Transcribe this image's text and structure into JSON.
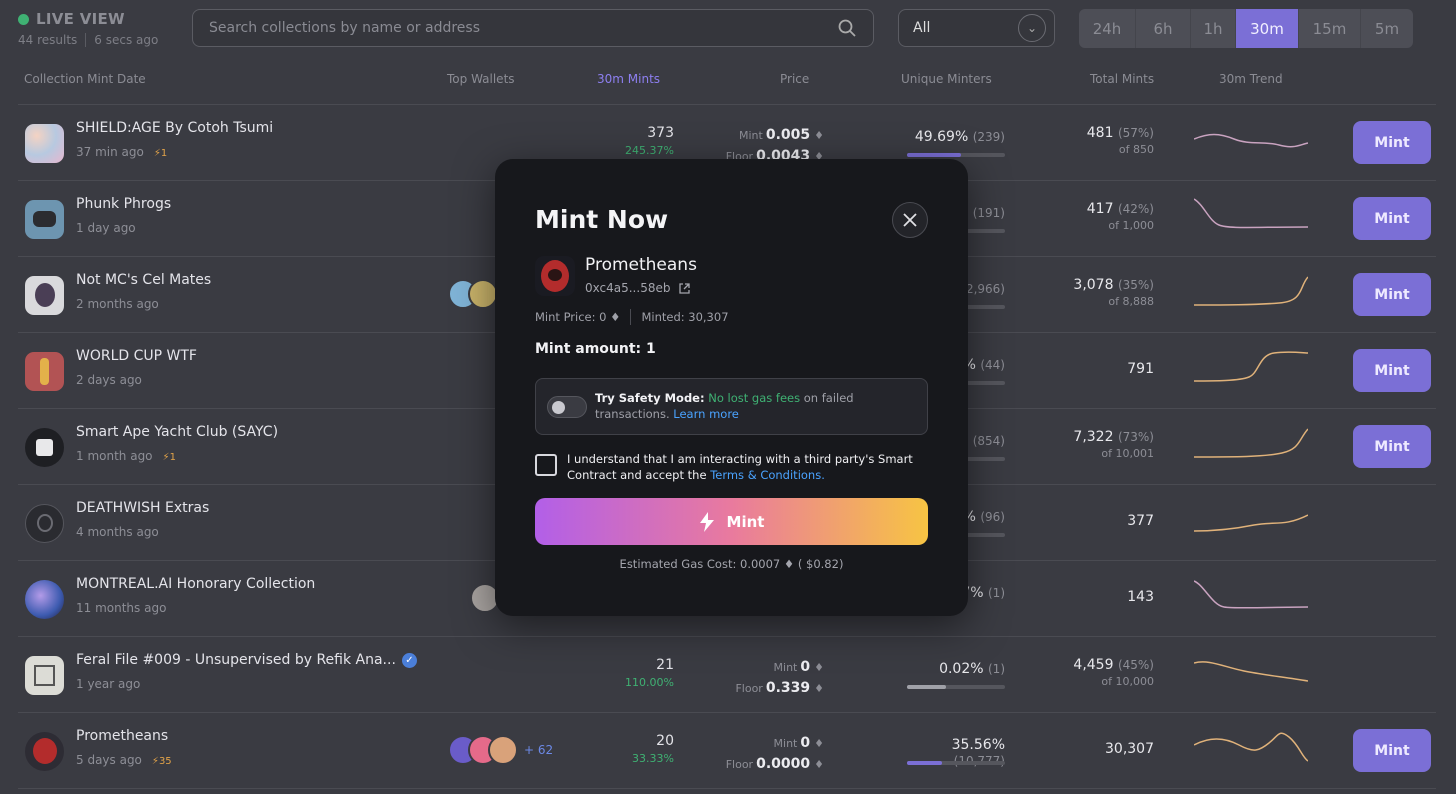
{
  "header": {
    "live_label": "LIVE VIEW",
    "results": "44 results",
    "updated": "6 secs ago",
    "search_placeholder": "Search collections by name or address",
    "filter_value": "All",
    "time_options": [
      "24h",
      "6h",
      "1h",
      "30m",
      "15m",
      "5m"
    ],
    "time_active": "30m"
  },
  "columns": {
    "collection": "Collection Mint Date",
    "top_wallets": "Top Wallets",
    "mints": "30m Mints",
    "price": "Price",
    "unique": "Unique Minters",
    "total": "Total Mints",
    "trend": "30m Trend"
  },
  "rows": [
    {
      "name": "SHIELD:AGE By Cotoh Tsumi",
      "age": "37 min ago",
      "tag": "1",
      "mints": "373",
      "mints_pct": "245.37%",
      "mint_label": "Mint",
      "mint_price": "0.005",
      "floor_label": "Floor",
      "floor_price": "0.0043",
      "unique_pct": "49.69%",
      "unique_cnt": "(239)",
      "unique_fill": 0.5,
      "total": "481",
      "total_pct": "(57%)",
      "total_of": "of 850",
      "has_button": true,
      "button": "Mint"
    },
    {
      "name": "Phunk Phrogs",
      "age": "1 day ago",
      "tag": "",
      "mints": "",
      "mints_pct": "",
      "unique_pct": "%",
      "unique_cnt": "(191)",
      "unique_fill": 0.4,
      "total": "417",
      "total_pct": "(42%)",
      "total_of": "of 1,000",
      "has_button": true,
      "button": "Mint"
    },
    {
      "name": "Not MC's Cel Mates",
      "age": "2 months ago",
      "tag": "",
      "unique_pct": "",
      "unique_cnt": "2,966)",
      "unique_fill": 0.35,
      "total": "3,078",
      "total_pct": "(35%)",
      "total_of": "of 8,888",
      "has_button": true,
      "button": "Mint"
    },
    {
      "name": "WORLD CUP WTF",
      "age": "2 days ago",
      "tag": "",
      "unique_pct": "%",
      "unique_cnt": "(44)",
      "unique_fill": 0.3,
      "total": "791",
      "total_pct": "",
      "total_of": "",
      "has_button": true,
      "button": "Mint"
    },
    {
      "name": "Smart Ape Yacht Club (SAYC)",
      "age": "1 month ago",
      "tag": "1",
      "unique_pct": "",
      "unique_cnt": "(854)",
      "unique_fill": 0.3,
      "total": "7,322",
      "total_pct": "(73%)",
      "total_of": "of 10,001",
      "has_button": true,
      "button": "Mint"
    },
    {
      "name": "DEATHWISH Extras",
      "age": "4 months ago",
      "tag": "",
      "unique_pct": "%",
      "unique_cnt": "(96)",
      "unique_fill": 0.3,
      "total": "377",
      "total_pct": "",
      "total_of": "",
      "has_button": false
    },
    {
      "name": "MONTREAL.AI Honorary Collection",
      "age": "11 months ago",
      "tag": "",
      "unique_pct": "7%",
      "unique_cnt": "(1)",
      "unique_fill": 0.3,
      "total": "143",
      "total_pct": "",
      "total_of": "",
      "has_button": false
    },
    {
      "name": "Feral File #009 - Unsupervised by Refik Ana...",
      "age": "1 year ago",
      "tag": "",
      "mints": "21",
      "mints_pct": "110.00%",
      "mint_label": "Mint",
      "mint_price": "0",
      "floor_label": "Floor",
      "floor_price": "0.339",
      "unique_pct": "0.02%",
      "unique_cnt": "(1)",
      "unique_fill": 0.4,
      "total": "4,459",
      "total_pct": "(45%)",
      "total_of": "of 10,000",
      "has_button": false
    },
    {
      "name": "Prometheans",
      "age": "5 days ago",
      "tag": "35",
      "wallets_more": "+ 62",
      "mints": "20",
      "mints_pct": "33.33%",
      "mint_label": "Mint",
      "mint_price": "0",
      "floor_label": "Floor",
      "floor_price": "0.0000",
      "unique_pct": "35.56%",
      "unique_cnt": "(10,777)",
      "unique_fill": 0.36,
      "total": "30,307",
      "total_pct": "",
      "total_of": "",
      "has_button": true,
      "button": "Mint"
    }
  ],
  "modal": {
    "title": "Mint Now",
    "collection": "Prometheans",
    "address": "0xc4a5...58eb",
    "mint_price": "Mint Price: 0",
    "minted": "Minted: 30,307",
    "amount": "Mint amount: 1",
    "safety_strong": "Try Safety Mode:",
    "safety_green": "No lost gas fees",
    "safety_rest": "on failed transactions.",
    "safety_link": "Learn more",
    "terms_text": "I understand that I am interacting with a third party's Smart Contract and accept the",
    "terms_link": "Terms & Conditions.",
    "mint_button": "Mint",
    "gas": "Estimated Gas Cost: 0.0007",
    "gas_usd": "( $0.82)"
  },
  "colors": {
    "accent": "#7b6fd6",
    "green": "#3fb173",
    "link": "#4aa3ff"
  }
}
